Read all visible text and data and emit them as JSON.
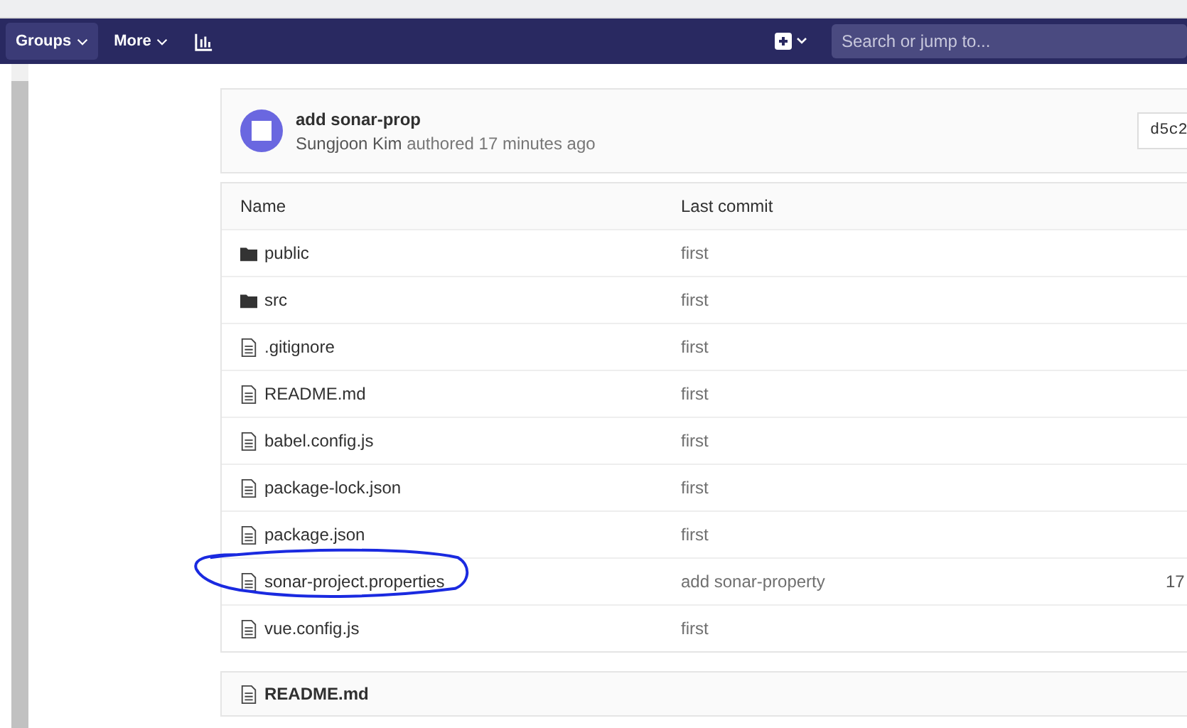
{
  "navbar": {
    "items": [
      {
        "label": "Groups",
        "selected": true
      },
      {
        "label": "More",
        "selected": false
      }
    ],
    "search": {
      "placeholder": "Search or jump to..."
    }
  },
  "commit": {
    "title": "add sonar-prop",
    "author": "Sungjoon Kim",
    "meta": "authored 17 minutes ago",
    "sha": "d5c2"
  },
  "table": {
    "columns": [
      "Name",
      "Last commit"
    ],
    "rows": [
      {
        "kind": "folder",
        "name": "public",
        "commit": "first"
      },
      {
        "kind": "folder",
        "name": "src",
        "commit": "first"
      },
      {
        "kind": "file",
        "name": ".gitignore",
        "commit": "first"
      },
      {
        "kind": "file",
        "name": "README.md",
        "commit": "first"
      },
      {
        "kind": "file",
        "name": "babel.config.js",
        "commit": "first"
      },
      {
        "kind": "file",
        "name": "package-lock.json",
        "commit": "first"
      },
      {
        "kind": "file",
        "name": "package.json",
        "commit": "first"
      },
      {
        "kind": "file",
        "name": "sonar-project.properties",
        "commit": "add sonar-property",
        "column_3": "17"
      },
      {
        "kind": "file",
        "name": "vue.config.js",
        "commit": "first"
      }
    ]
  },
  "readme": {
    "title": "README.md"
  }
}
